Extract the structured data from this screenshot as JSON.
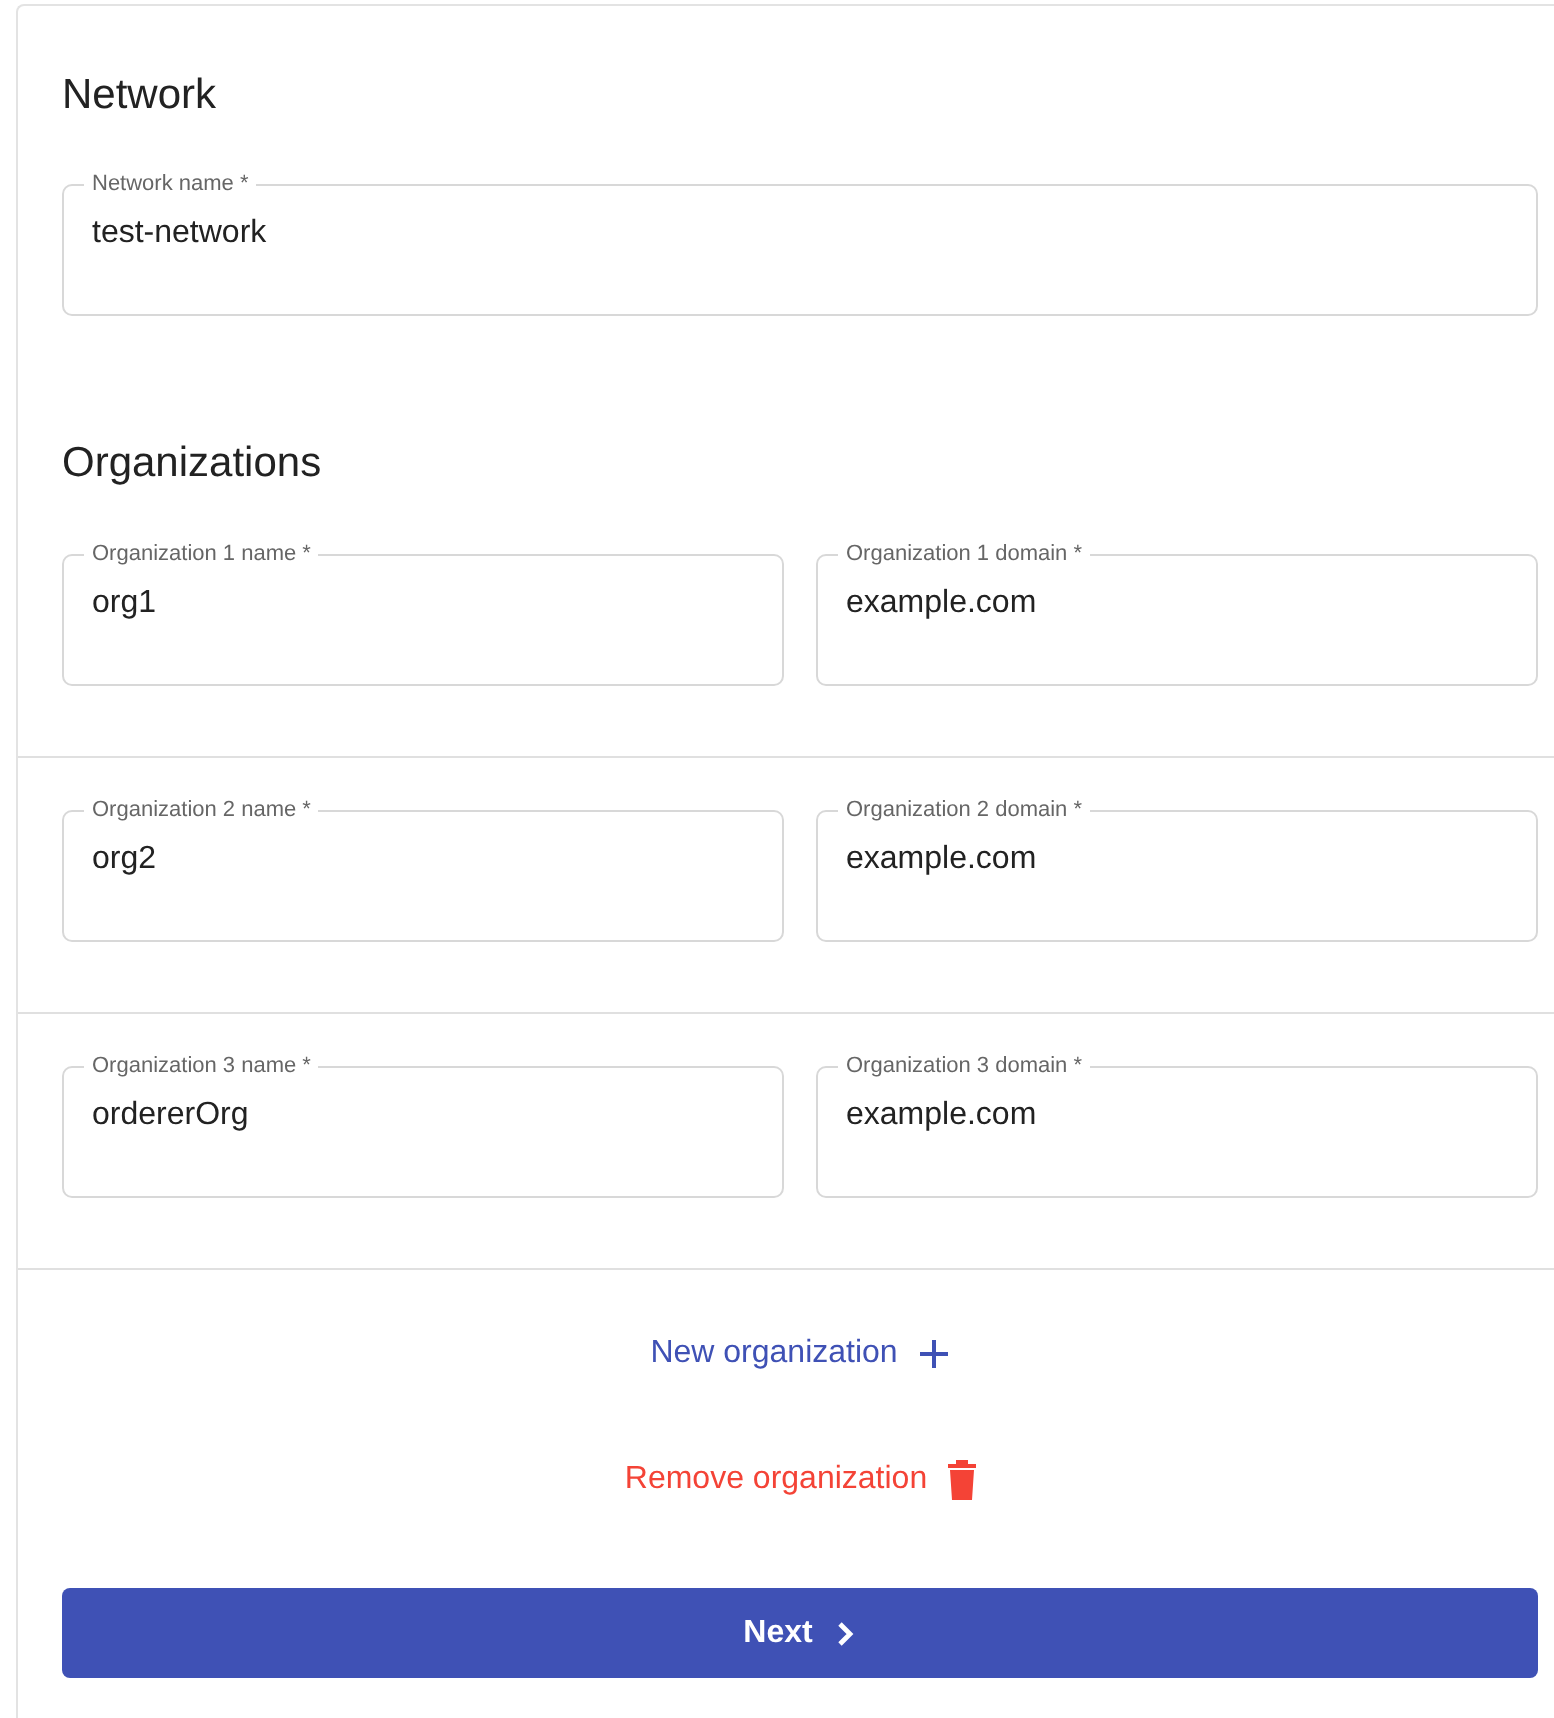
{
  "network": {
    "heading": "Network",
    "field": {
      "label": "Network name *",
      "value": "test-network"
    }
  },
  "organizations": {
    "heading": "Organizations",
    "rows": [
      {
        "name_field": {
          "label": "Organization 1 name *",
          "value": "org1"
        },
        "domain_field": {
          "label": "Organization 1 domain *",
          "value": "example.com"
        }
      },
      {
        "name_field": {
          "label": "Organization 2 name *",
          "value": "org2"
        },
        "domain_field": {
          "label": "Organization 2 domain *",
          "value": "example.com"
        }
      },
      {
        "name_field": {
          "label": "Organization 3 name *",
          "value": "ordererOrg"
        },
        "domain_field": {
          "label": "Organization 3 domain *",
          "value": "example.com"
        }
      }
    ]
  },
  "actions": {
    "new_organization": "New organization",
    "remove_organization": "Remove organization",
    "next": "Next"
  }
}
